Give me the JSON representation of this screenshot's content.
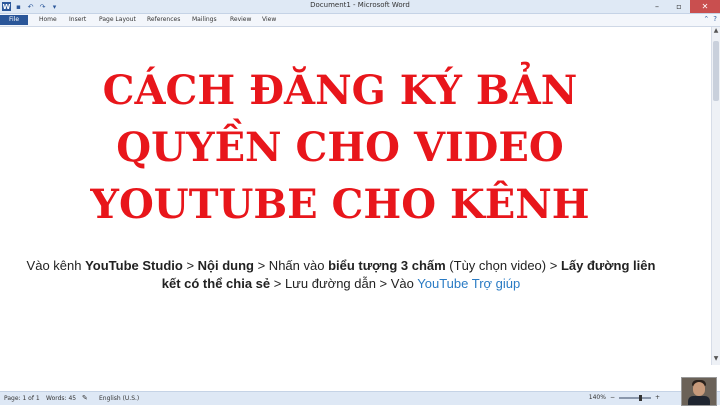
{
  "window": {
    "title": "Document1 - Microsoft Word"
  },
  "quick_access": {
    "icons": [
      "word-logo-icon",
      "save-icon",
      "undo-icon",
      "redo-icon",
      "customize-icon"
    ]
  },
  "ribbon": {
    "tabs": [
      "File",
      "Home",
      "Insert",
      "Page Layout",
      "References",
      "Mailings",
      "Review",
      "View"
    ]
  },
  "document": {
    "heading_lines": [
      "CÁCH ĐĂNG KÝ BẢN",
      "QUYỀN CHO VIDEO",
      "YOUTUBE CHO KÊNH"
    ],
    "desc": {
      "p1": "Vào kênh ",
      "b1": "YouTube Studio",
      "p2": " > ",
      "b2": "Nội dung",
      "p3": " > Nhấn vào ",
      "b3": "biểu tượng 3 chấm",
      "p4": " (Tùy chọn video) > ",
      "b4": "Lấy đường liên kết có thể chia sẻ",
      "p5": " > Lưu đường dẫn > Vào ",
      "link": "YouTube Trợ giúp"
    }
  },
  "status": {
    "page": "Page: 1 of 1",
    "words": "Words: 45",
    "language": "English (U.S.)",
    "zoom": "140%"
  },
  "colors": {
    "heading": "#e8161b",
    "file_tab": "#2a5699",
    "link": "#2a7bc4"
  }
}
